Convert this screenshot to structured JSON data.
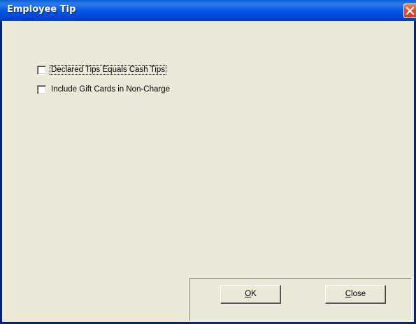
{
  "window": {
    "title": "Employee Tip",
    "close_icon": "close-x-icon"
  },
  "options": [
    {
      "label": "Declared Tips Equals Cash Tips",
      "checked": false,
      "focused": true
    },
    {
      "label": "Include Gift Cards in Non-Charge",
      "checked": false,
      "focused": false
    }
  ],
  "buttons": {
    "ok": {
      "mnemonic": "O",
      "rest": "K"
    },
    "close": {
      "mnemonic": "C",
      "rest": "lose"
    }
  },
  "colors": {
    "titlebar": "#0054e3",
    "window_bg": "#ece9d8",
    "close_button": "#d7522a"
  }
}
